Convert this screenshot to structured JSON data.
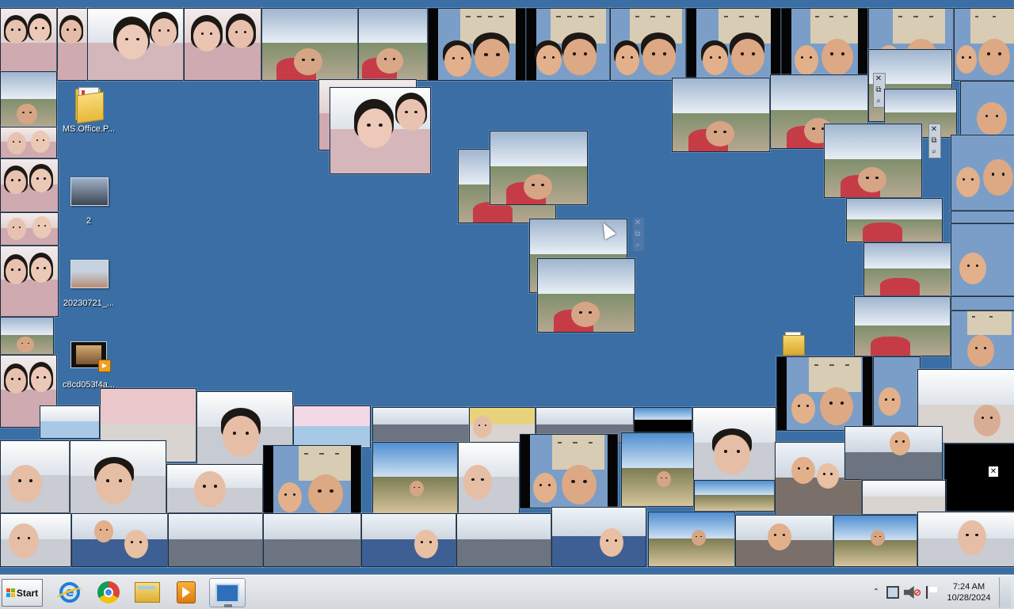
{
  "desktop_icons": [
    {
      "label": "MS.Office.P...",
      "icon": "folder-icon"
    },
    {
      "label": "2",
      "icon": "image-thumbnail-icon"
    },
    {
      "label": "20230721_...",
      "icon": "image-thumbnail-icon"
    },
    {
      "label": "c8cd053f4a...",
      "icon": "video-file-icon"
    }
  ],
  "window_controls": {
    "close": "✕",
    "restore": "⧉",
    "search": "⌕"
  },
  "lone_close_button": "✕",
  "taskbar": {
    "start_label": "Start",
    "pinned": [
      {
        "name": "internet-explorer",
        "icon": "ie-icon"
      },
      {
        "name": "google-chrome",
        "icon": "chrome-icon"
      },
      {
        "name": "windows-explorer",
        "icon": "folder-icon"
      },
      {
        "name": "media-player",
        "icon": "media-player-icon"
      },
      {
        "name": "remote-desktop",
        "icon": "remote-desktop-icon",
        "active": true
      }
    ],
    "tray": {
      "show_hidden": "⌃",
      "time": "7:24 AM",
      "date": "10/28/2024"
    }
  },
  "colors": {
    "desktop_background": "#3a6ea5",
    "taskbar": "#d4d8de",
    "start_flag": [
      "#f25022",
      "#7fba00",
      "#00a4ef",
      "#ffb900"
    ]
  }
}
